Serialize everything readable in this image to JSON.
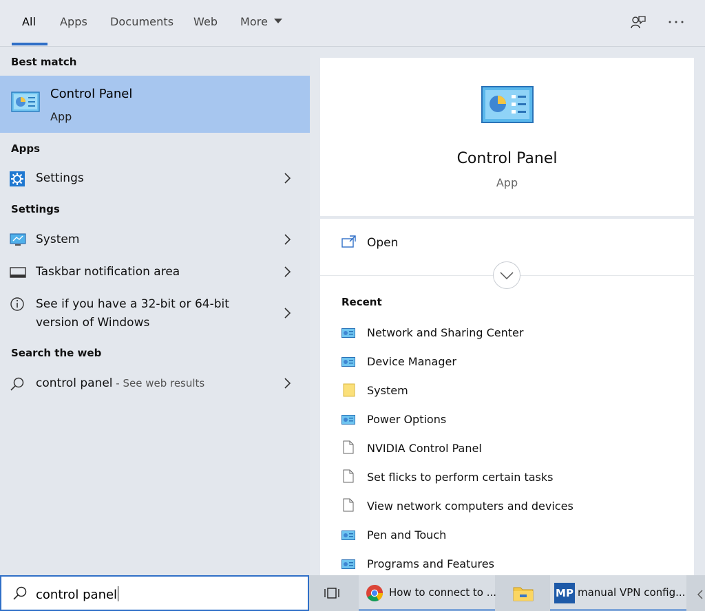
{
  "tabs": [
    {
      "label": "All",
      "active": true
    },
    {
      "label": "Apps"
    },
    {
      "label": "Documents"
    },
    {
      "label": "Web"
    },
    {
      "label": "More"
    }
  ],
  "left": {
    "best_match_title": "Best match",
    "best_match": {
      "name": "Control Panel",
      "type": "App",
      "icon": "control-panel-icon"
    },
    "apps_title": "Apps",
    "apps": [
      {
        "label": "Settings",
        "icon": "gear-icon"
      }
    ],
    "settings_title": "Settings",
    "settings": [
      {
        "label": "System",
        "icon": "monitor-icon"
      },
      {
        "label": "Taskbar notification area",
        "icon": "taskbar-icon"
      },
      {
        "label": "See if you have a 32-bit or 64-bit",
        "label2": "version of Windows",
        "icon": "info-icon"
      }
    ],
    "web_title": "Search the web",
    "web": {
      "query": "control panel",
      "hint": " - See web results",
      "icon": "search-icon"
    }
  },
  "detail": {
    "name": "Control Panel",
    "type": "App",
    "open_label": "Open",
    "recent_title": "Recent",
    "recent": [
      {
        "label": "Network and Sharing Center",
        "icon": "control-panel-small-icon"
      },
      {
        "label": "Device Manager",
        "icon": "control-panel-small-icon"
      },
      {
        "label": "System",
        "icon": "folder-icon"
      },
      {
        "label": "Power Options",
        "icon": "control-panel-small-icon"
      },
      {
        "label": "NVIDIA Control Panel",
        "icon": "document-icon"
      },
      {
        "label": "Set flicks to perform certain tasks",
        "icon": "document-icon"
      },
      {
        "label": "View network computers and devices",
        "icon": "document-icon"
      },
      {
        "label": "Pen and Touch",
        "icon": "control-panel-small-icon"
      },
      {
        "label": "Programs and Features",
        "icon": "control-panel-small-icon"
      }
    ]
  },
  "taskbar": {
    "search_value": "control panel",
    "chrome_label": "How to connect to ...",
    "mp_badge": "MP",
    "mp_label": "manual VPN config..."
  },
  "colors": {
    "accent": "#2f6fc7",
    "selected": "#a7c6ef",
    "panel": "#e3e7ed"
  }
}
